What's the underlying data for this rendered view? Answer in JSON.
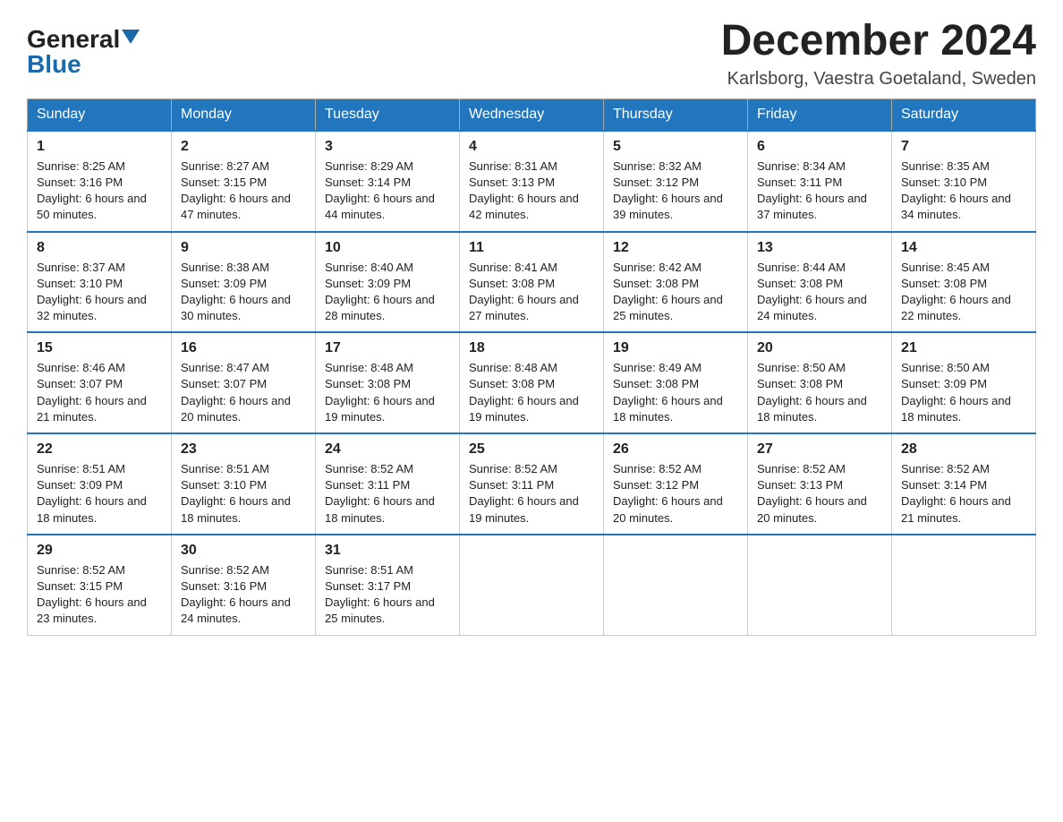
{
  "logo": {
    "general": "General",
    "blue": "Blue"
  },
  "title": "December 2024",
  "subtitle": "Karlsborg, Vaestra Goetaland, Sweden",
  "days_of_week": [
    "Sunday",
    "Monday",
    "Tuesday",
    "Wednesday",
    "Thursday",
    "Friday",
    "Saturday"
  ],
  "weeks": [
    [
      {
        "num": "1",
        "sunrise": "8:25 AM",
        "sunset": "3:16 PM",
        "daylight": "6 hours and 50 minutes."
      },
      {
        "num": "2",
        "sunrise": "8:27 AM",
        "sunset": "3:15 PM",
        "daylight": "6 hours and 47 minutes."
      },
      {
        "num": "3",
        "sunrise": "8:29 AM",
        "sunset": "3:14 PM",
        "daylight": "6 hours and 44 minutes."
      },
      {
        "num": "4",
        "sunrise": "8:31 AM",
        "sunset": "3:13 PM",
        "daylight": "6 hours and 42 minutes."
      },
      {
        "num": "5",
        "sunrise": "8:32 AM",
        "sunset": "3:12 PM",
        "daylight": "6 hours and 39 minutes."
      },
      {
        "num": "6",
        "sunrise": "8:34 AM",
        "sunset": "3:11 PM",
        "daylight": "6 hours and 37 minutes."
      },
      {
        "num": "7",
        "sunrise": "8:35 AM",
        "sunset": "3:10 PM",
        "daylight": "6 hours and 34 minutes."
      }
    ],
    [
      {
        "num": "8",
        "sunrise": "8:37 AM",
        "sunset": "3:10 PM",
        "daylight": "6 hours and 32 minutes."
      },
      {
        "num": "9",
        "sunrise": "8:38 AM",
        "sunset": "3:09 PM",
        "daylight": "6 hours and 30 minutes."
      },
      {
        "num": "10",
        "sunrise": "8:40 AM",
        "sunset": "3:09 PM",
        "daylight": "6 hours and 28 minutes."
      },
      {
        "num": "11",
        "sunrise": "8:41 AM",
        "sunset": "3:08 PM",
        "daylight": "6 hours and 27 minutes."
      },
      {
        "num": "12",
        "sunrise": "8:42 AM",
        "sunset": "3:08 PM",
        "daylight": "6 hours and 25 minutes."
      },
      {
        "num": "13",
        "sunrise": "8:44 AM",
        "sunset": "3:08 PM",
        "daylight": "6 hours and 24 minutes."
      },
      {
        "num": "14",
        "sunrise": "8:45 AM",
        "sunset": "3:08 PM",
        "daylight": "6 hours and 22 minutes."
      }
    ],
    [
      {
        "num": "15",
        "sunrise": "8:46 AM",
        "sunset": "3:07 PM",
        "daylight": "6 hours and 21 minutes."
      },
      {
        "num": "16",
        "sunrise": "8:47 AM",
        "sunset": "3:07 PM",
        "daylight": "6 hours and 20 minutes."
      },
      {
        "num": "17",
        "sunrise": "8:48 AM",
        "sunset": "3:08 PM",
        "daylight": "6 hours and 19 minutes."
      },
      {
        "num": "18",
        "sunrise": "8:48 AM",
        "sunset": "3:08 PM",
        "daylight": "6 hours and 19 minutes."
      },
      {
        "num": "19",
        "sunrise": "8:49 AM",
        "sunset": "3:08 PM",
        "daylight": "6 hours and 18 minutes."
      },
      {
        "num": "20",
        "sunrise": "8:50 AM",
        "sunset": "3:08 PM",
        "daylight": "6 hours and 18 minutes."
      },
      {
        "num": "21",
        "sunrise": "8:50 AM",
        "sunset": "3:09 PM",
        "daylight": "6 hours and 18 minutes."
      }
    ],
    [
      {
        "num": "22",
        "sunrise": "8:51 AM",
        "sunset": "3:09 PM",
        "daylight": "6 hours and 18 minutes."
      },
      {
        "num": "23",
        "sunrise": "8:51 AM",
        "sunset": "3:10 PM",
        "daylight": "6 hours and 18 minutes."
      },
      {
        "num": "24",
        "sunrise": "8:52 AM",
        "sunset": "3:11 PM",
        "daylight": "6 hours and 18 minutes."
      },
      {
        "num": "25",
        "sunrise": "8:52 AM",
        "sunset": "3:11 PM",
        "daylight": "6 hours and 19 minutes."
      },
      {
        "num": "26",
        "sunrise": "8:52 AM",
        "sunset": "3:12 PM",
        "daylight": "6 hours and 20 minutes."
      },
      {
        "num": "27",
        "sunrise": "8:52 AM",
        "sunset": "3:13 PM",
        "daylight": "6 hours and 20 minutes."
      },
      {
        "num": "28",
        "sunrise": "8:52 AM",
        "sunset": "3:14 PM",
        "daylight": "6 hours and 21 minutes."
      }
    ],
    [
      {
        "num": "29",
        "sunrise": "8:52 AM",
        "sunset": "3:15 PM",
        "daylight": "6 hours and 23 minutes."
      },
      {
        "num": "30",
        "sunrise": "8:52 AM",
        "sunset": "3:16 PM",
        "daylight": "6 hours and 24 minutes."
      },
      {
        "num": "31",
        "sunrise": "8:51 AM",
        "sunset": "3:17 PM",
        "daylight": "6 hours and 25 minutes."
      },
      null,
      null,
      null,
      null
    ]
  ]
}
